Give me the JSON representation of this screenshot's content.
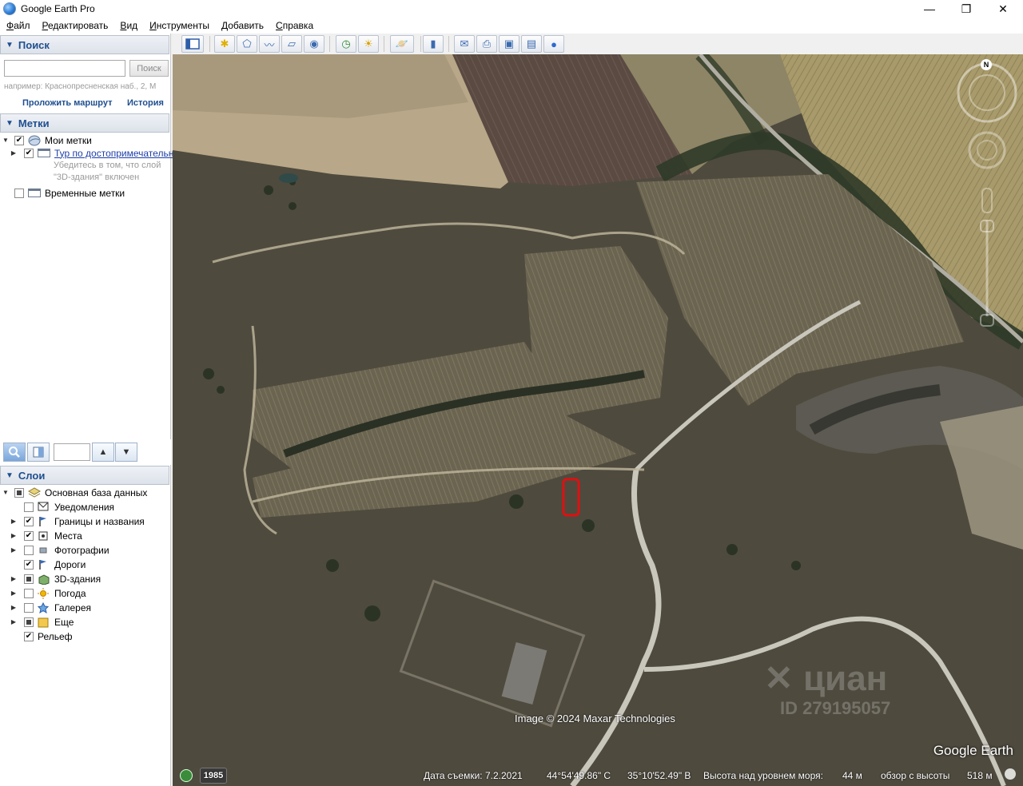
{
  "window": {
    "title": "Google Earth Pro",
    "minimize": "—",
    "maximize": "❐",
    "close": "✕"
  },
  "menu": [
    {
      "label": "Файл",
      "key": "Ф",
      "rest": "айл"
    },
    {
      "label": "Редактировать",
      "key": "Р",
      "rest": "едактировать"
    },
    {
      "label": "Вид",
      "key": "В",
      "rest": "ид"
    },
    {
      "label": "Инструменты",
      "key": "И",
      "rest": "нструменты"
    },
    {
      "label": "Добавить",
      "key": "Д",
      "rest": "обавить"
    },
    {
      "label": "Справка",
      "key": "С",
      "rest": "правка"
    }
  ],
  "search": {
    "header": "Поиск",
    "input_value": "",
    "button": "Поиск",
    "hint": "например: Краснопресненская наб., 2, М",
    "route_link": "Проложить маршрут",
    "history_link": "История"
  },
  "places": {
    "header": "Метки",
    "my_places": "Мои метки",
    "tour": "Тур по достопримечательн",
    "tour_note_1": "Убедитесь в том, что слой",
    "tour_note_2": "\"3D-здания\" включен",
    "temporary": "Временные метки"
  },
  "layers": {
    "header": "Слои",
    "root": "Основная база данных",
    "items": [
      {
        "label": "Уведомления",
        "checked": false,
        "icon": "mail-icon",
        "expandable": false
      },
      {
        "label": "Границы и названия",
        "checked": true,
        "icon": "flag-icon",
        "expandable": true
      },
      {
        "label": "Места",
        "checked": true,
        "icon": "places-icon",
        "expandable": true
      },
      {
        "label": "Фотографии",
        "checked": false,
        "icon": "photo-icon",
        "expandable": true
      },
      {
        "label": "Дороги",
        "checked": true,
        "icon": "road-icon",
        "expandable": false
      },
      {
        "label": "3D-здания",
        "checked": "partial",
        "icon": "building-icon",
        "expandable": true
      },
      {
        "label": "Погода",
        "checked": false,
        "icon": "weather-icon",
        "expandable": true
      },
      {
        "label": "Галерея",
        "checked": false,
        "icon": "gallery-icon",
        "expandable": true
      },
      {
        "label": "Еще",
        "checked": "partial",
        "icon": "more-icon",
        "expandable": true
      }
    ],
    "terrain": "Рельеф"
  },
  "map": {
    "credit": "Image © 2024 Maxar Technologies",
    "brand": "Google Earth",
    "watermark_logo": "✕ циан",
    "watermark_id": "ID 279195057",
    "compass_north": "N"
  },
  "status": {
    "year": "1985",
    "capture_label": "Дата съемки: 7.2.2021",
    "lat": "44°54'49.86\" С",
    "lon": "35°10'52.49\" В",
    "elev_label": "Высота над уровнем моря:",
    "elev_value": "44 м",
    "eye_label": "обзор с высоты",
    "eye_value": "518 м"
  },
  "colors": {
    "header_text": "#1f4f90",
    "marker": "#e01010"
  }
}
